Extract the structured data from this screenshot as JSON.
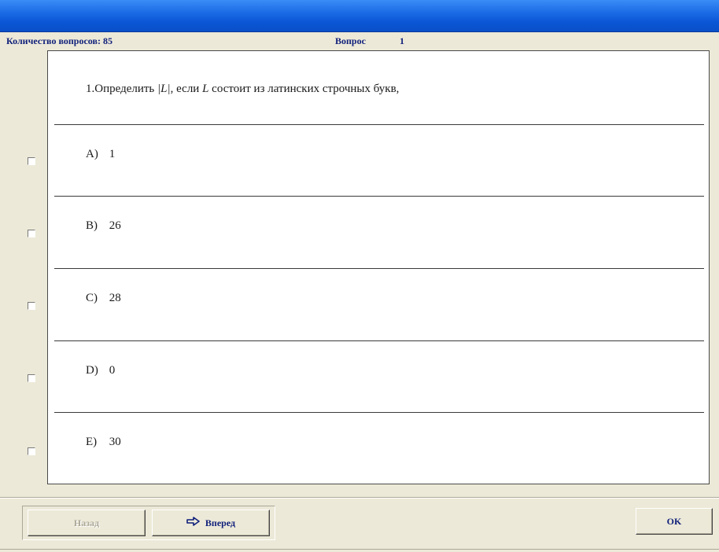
{
  "info": {
    "count_label": "Количество вопросов: 85",
    "question_label": "Вопрос",
    "question_number": "1"
  },
  "question": {
    "prefix": "1.Определить",
    "abs_expr": "|L|",
    "middle": ", если",
    "var": "L",
    "suffix": "состоит из латинских строчных букв,"
  },
  "answers": [
    {
      "letter": "A)",
      "value": "1"
    },
    {
      "letter": "B)",
      "value": "26"
    },
    {
      "letter": "C)",
      "value": "28"
    },
    {
      "letter": "D)",
      "value": "0"
    },
    {
      "letter": "E)",
      "value": "30"
    }
  ],
  "buttons": {
    "back": "Назад",
    "forward": "Вперед",
    "ok": "OK"
  },
  "icons": {
    "forward": "arrow-right-icon"
  },
  "colors": {
    "titlebar": "#0a56d6",
    "info_text": "#0f1f7a",
    "background": "#ece9d8"
  }
}
